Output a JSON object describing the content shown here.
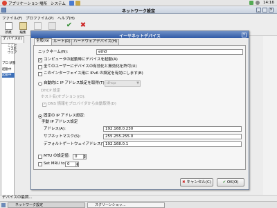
{
  "top_panel": {
    "menus": [
      "アプリケーション",
      "場所",
      "システム"
    ],
    "clock": "14:16"
  },
  "window": {
    "title": "ネットワーク設定",
    "menus": [
      "ファイル(F)",
      "プロファイル(P)",
      "ヘルプ(H)"
    ],
    "toolbar": [
      {
        "label": "新規",
        "icon": "new-icon"
      },
      {
        "label": "編集",
        "icon": "edit-icon"
      },
      {
        "label": "コピー",
        "icon": "copy-icon"
      },
      {
        "label": "削除",
        "icon": "delete-icon"
      },
      {
        "label": "有効",
        "icon": "activate-icon"
      },
      {
        "label": "無効",
        "icon": "deactivate-icon"
      }
    ],
    "left_tab": "デバイス(i)",
    "left_side_text": [
      "ここで",
      "イスを",
      "ウェア"
    ],
    "left_list_header": "プロ 状態",
    "left_rows": [
      "起動中",
      "起動中"
    ]
  },
  "dialog": {
    "title": "イーサネットデバイス",
    "tabs": [
      "全般(G)",
      "ルート(R)",
      "ハードウェアデバイス(H)"
    ],
    "nickname_label": "ニックネーム(N):",
    "nickname_value": "eth0",
    "check_boot": "コンピュータの起動時にデバイスを起動(A)",
    "check_users": "全てのユーザーにデバイスの有効化と無効化を許可(U)",
    "check_ipv6": "このインターフェイス用に IPv6 の設定を有効にします(B)",
    "auto_ip_label": "自動的に IP アドレス設定を取得(T):",
    "auto_ip_method": "dhcp",
    "dhcp_settings_label": "DHCP 設定",
    "hostname_label": "ホスト名(オプション)(O):",
    "dns_label": "DNS 情報をプロバイダから自動取得(D)",
    "static_label": "固定の IP アドレス設定:",
    "manual_group": "手動 IP アドレス設定",
    "address_label": "アドレス(A):",
    "address_value": "192.168.0.230",
    "subnet_label": "サブネットマスク(S):",
    "subnet_value": "255.255.255.0",
    "gateway_label": "デフォルトゲートウェイアドレス(T):",
    "gateway_value": "192.168.0.1",
    "mtu_label": "MTU の設定値:",
    "mtu_value": "0",
    "mru_label": "Set MRU to",
    "mru_value": "0",
    "cancel_label": "キャンセル(C)",
    "ok_label": "OK(O)"
  },
  "status_text": "デバイスの最調...",
  "taskbar": [
    {
      "label": "ネットワーク設定"
    },
    {
      "label": "スクリーンショッ..."
    }
  ],
  "colors": {
    "title_active": "#2f5aa6",
    "title_inactive": "#c9d2df"
  }
}
